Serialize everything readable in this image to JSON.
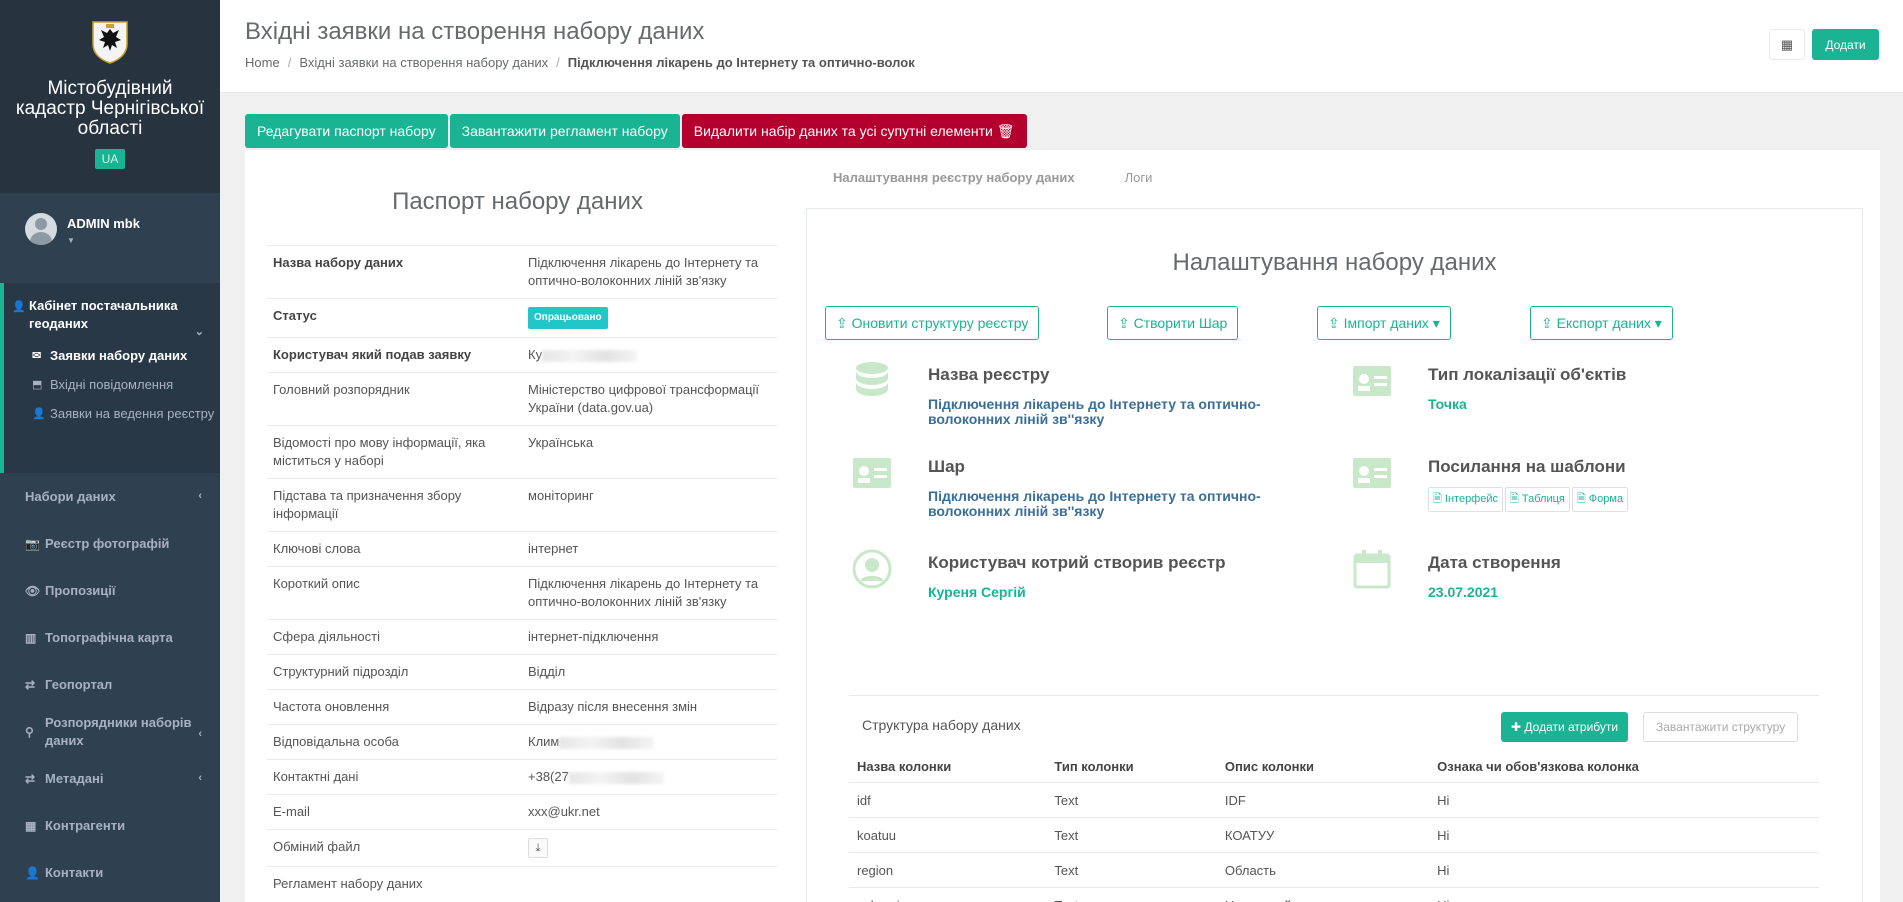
{
  "sidebar": {
    "brand_title": "Містобудівний кадастр Чернігівської області",
    "lang_badge": "UA",
    "user_name": "ADMIN mbk",
    "cabinet_title": "Кабінет постачальника геоданих",
    "cabinet_items": [
      {
        "label": "Заявки набору даних",
        "icon": "envelope-icon"
      },
      {
        "label": "Вхідні повідомлення",
        "icon": "inbox-icon"
      },
      {
        "label": "Заявки на ведення реєстру",
        "icon": "user-icon"
      }
    ],
    "nav": [
      {
        "label": "Набори даних",
        "icon": "",
        "chevron": true
      },
      {
        "label": "Реєстр фотографій",
        "icon": "camera-icon",
        "chevron": false
      },
      {
        "label": "Пропозиції",
        "icon": "eye-icon",
        "chevron": false
      },
      {
        "label": "Топографічна карта",
        "icon": "map-icon",
        "chevron": false
      },
      {
        "label": "Геопортал",
        "icon": "refresh-icon",
        "chevron": false
      },
      {
        "label": "Розпорядники наборів даних",
        "icon": "marker-icon",
        "chevron": true
      },
      {
        "label": "Метадані",
        "icon": "refresh-icon",
        "chevron": true
      },
      {
        "label": "Контрагенти",
        "icon": "building-icon",
        "chevron": false
      },
      {
        "label": "Контакти",
        "icon": "user-icon",
        "chevron": false
      }
    ]
  },
  "header": {
    "title": "Вхідні заявки на створення набору даних",
    "breadcrumb": [
      "Home",
      "Вхідні заявки на створення набору даних",
      "Підключення лікарень до Інтернету та оптично-волок"
    ],
    "add_label": "Додати"
  },
  "actions": {
    "edit": "Редагувати паспорт набору",
    "upload_reg": "Завантажити регламент набору",
    "delete": "Видалити набір даних та усі супутні елементи"
  },
  "passport": {
    "title": "Паспорт набору даних",
    "rows": [
      {
        "k": "Назва набору даних",
        "v": "Підключення лікарень до Інтернету та оптично-волоконних ліній зв'язку",
        "bold": true
      },
      {
        "k": "Статус",
        "v": "Опрацьовано",
        "bold": true,
        "badge": true
      },
      {
        "k": "Користувач який подав заявку",
        "v": "Ку",
        "bold": true,
        "blur": true
      },
      {
        "k": "Головний розпорядник",
        "v": "Міністерство цифрової трансформації України (data.gov.ua)"
      },
      {
        "k": "Відомості про мову інформації, яка міститься у наборі",
        "v": "Українська"
      },
      {
        "k": "Підстава та призначення збору інформації",
        "v": "моніторинг"
      },
      {
        "k": "Ключові слова",
        "v": "інтернет"
      },
      {
        "k": "Короткий опис",
        "v": "Підключення лікарень до Інтернету та оптично-волоконних ліній зв'язку"
      },
      {
        "k": "Сфера діяльності",
        "v": "інтернет-підключення"
      },
      {
        "k": "Структурний підрозділ",
        "v": "Відділ"
      },
      {
        "k": "Частота оновлення",
        "v": "Відразу після внесення змін"
      },
      {
        "k": "Відповідальна особа",
        "v": "Клим",
        "blur": true
      },
      {
        "k": "Контактні дані",
        "v": "+38(27",
        "blur": true
      },
      {
        "k": "E-mail",
        "v": "xxx@ukr.net"
      },
      {
        "k": "Обміний файл",
        "v": "",
        "download": true
      },
      {
        "k": "Регламент набору даних",
        "v": ""
      }
    ]
  },
  "tabs": [
    "Налаштування реєстру набору даних",
    "Логи"
  ],
  "settings": {
    "title": "Налаштування набору даних",
    "buttons": {
      "refresh": "Оновити структуру реєстру",
      "layer": "Створити Шар",
      "import": "Імпорт даних",
      "export": "Експорт даних"
    },
    "registry_name_label": "Назва реєстру",
    "registry_name": "Підключення лікарень до Інтернету та оптично-волоконних ліній зв''язку",
    "loc_type_label": "Тип локалізації об'єктів",
    "loc_type": "Точка",
    "layer_label": "Шар",
    "layer": "Підключення лікарень до Інтернету та оптично-волоконних ліній зв''язку",
    "templates_label": "Посилання на шаблони",
    "templates": [
      "Інтерфейс",
      "Таблиця",
      "Форма"
    ],
    "creator_label": "Користувач котрий створив реєстр",
    "creator": "Куреня Сергій",
    "created_label": "Дата створення",
    "created": "23.07.2021"
  },
  "structure": {
    "title": "Структура набору даних",
    "add_attr": "Додати атрибути",
    "load": "Завантажити структуру",
    "headers": [
      "Назва колонки",
      "Тип колонки",
      "Опис колонки",
      "Ознака чи обов'язкова колонка"
    ],
    "rows": [
      [
        "idf",
        "Text",
        "IDF",
        "Ні"
      ],
      [
        "koatuu",
        "Text",
        "КОАТУУ",
        "Ні"
      ],
      [
        "region",
        "Text",
        "Область",
        "Ні"
      ],
      [
        "subregion",
        "Text",
        "Населений пункт",
        "Ні"
      ]
    ]
  },
  "colors": {
    "accent": "#1ab394",
    "danger": "#b3002d",
    "sidebar": "#2f4050"
  }
}
